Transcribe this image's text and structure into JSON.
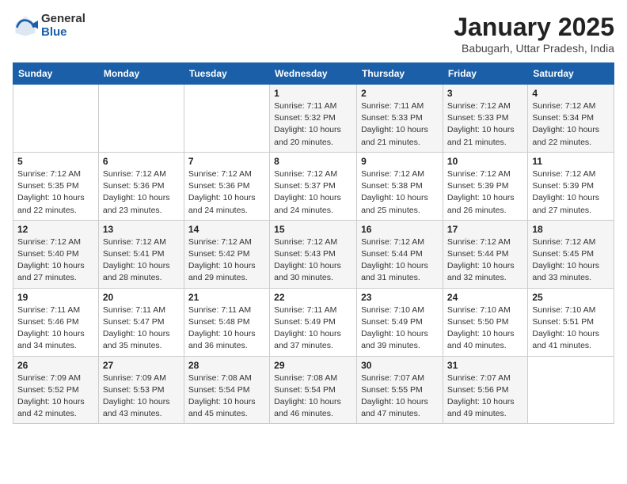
{
  "header": {
    "logo_general": "General",
    "logo_blue": "Blue",
    "title": "January 2025",
    "subtitle": "Babugarh, Uttar Pradesh, India"
  },
  "days_of_week": [
    "Sunday",
    "Monday",
    "Tuesday",
    "Wednesday",
    "Thursday",
    "Friday",
    "Saturday"
  ],
  "weeks": [
    [
      {
        "num": "",
        "info": ""
      },
      {
        "num": "",
        "info": ""
      },
      {
        "num": "",
        "info": ""
      },
      {
        "num": "1",
        "info": "Sunrise: 7:11 AM\nSunset: 5:32 PM\nDaylight: 10 hours\nand 20 minutes."
      },
      {
        "num": "2",
        "info": "Sunrise: 7:11 AM\nSunset: 5:33 PM\nDaylight: 10 hours\nand 21 minutes."
      },
      {
        "num": "3",
        "info": "Sunrise: 7:12 AM\nSunset: 5:33 PM\nDaylight: 10 hours\nand 21 minutes."
      },
      {
        "num": "4",
        "info": "Sunrise: 7:12 AM\nSunset: 5:34 PM\nDaylight: 10 hours\nand 22 minutes."
      }
    ],
    [
      {
        "num": "5",
        "info": "Sunrise: 7:12 AM\nSunset: 5:35 PM\nDaylight: 10 hours\nand 22 minutes."
      },
      {
        "num": "6",
        "info": "Sunrise: 7:12 AM\nSunset: 5:36 PM\nDaylight: 10 hours\nand 23 minutes."
      },
      {
        "num": "7",
        "info": "Sunrise: 7:12 AM\nSunset: 5:36 PM\nDaylight: 10 hours\nand 24 minutes."
      },
      {
        "num": "8",
        "info": "Sunrise: 7:12 AM\nSunset: 5:37 PM\nDaylight: 10 hours\nand 24 minutes."
      },
      {
        "num": "9",
        "info": "Sunrise: 7:12 AM\nSunset: 5:38 PM\nDaylight: 10 hours\nand 25 minutes."
      },
      {
        "num": "10",
        "info": "Sunrise: 7:12 AM\nSunset: 5:39 PM\nDaylight: 10 hours\nand 26 minutes."
      },
      {
        "num": "11",
        "info": "Sunrise: 7:12 AM\nSunset: 5:39 PM\nDaylight: 10 hours\nand 27 minutes."
      }
    ],
    [
      {
        "num": "12",
        "info": "Sunrise: 7:12 AM\nSunset: 5:40 PM\nDaylight: 10 hours\nand 27 minutes."
      },
      {
        "num": "13",
        "info": "Sunrise: 7:12 AM\nSunset: 5:41 PM\nDaylight: 10 hours\nand 28 minutes."
      },
      {
        "num": "14",
        "info": "Sunrise: 7:12 AM\nSunset: 5:42 PM\nDaylight: 10 hours\nand 29 minutes."
      },
      {
        "num": "15",
        "info": "Sunrise: 7:12 AM\nSunset: 5:43 PM\nDaylight: 10 hours\nand 30 minutes."
      },
      {
        "num": "16",
        "info": "Sunrise: 7:12 AM\nSunset: 5:44 PM\nDaylight: 10 hours\nand 31 minutes."
      },
      {
        "num": "17",
        "info": "Sunrise: 7:12 AM\nSunset: 5:44 PM\nDaylight: 10 hours\nand 32 minutes."
      },
      {
        "num": "18",
        "info": "Sunrise: 7:12 AM\nSunset: 5:45 PM\nDaylight: 10 hours\nand 33 minutes."
      }
    ],
    [
      {
        "num": "19",
        "info": "Sunrise: 7:11 AM\nSunset: 5:46 PM\nDaylight: 10 hours\nand 34 minutes."
      },
      {
        "num": "20",
        "info": "Sunrise: 7:11 AM\nSunset: 5:47 PM\nDaylight: 10 hours\nand 35 minutes."
      },
      {
        "num": "21",
        "info": "Sunrise: 7:11 AM\nSunset: 5:48 PM\nDaylight: 10 hours\nand 36 minutes."
      },
      {
        "num": "22",
        "info": "Sunrise: 7:11 AM\nSunset: 5:49 PM\nDaylight: 10 hours\nand 37 minutes."
      },
      {
        "num": "23",
        "info": "Sunrise: 7:10 AM\nSunset: 5:49 PM\nDaylight: 10 hours\nand 39 minutes."
      },
      {
        "num": "24",
        "info": "Sunrise: 7:10 AM\nSunset: 5:50 PM\nDaylight: 10 hours\nand 40 minutes."
      },
      {
        "num": "25",
        "info": "Sunrise: 7:10 AM\nSunset: 5:51 PM\nDaylight: 10 hours\nand 41 minutes."
      }
    ],
    [
      {
        "num": "26",
        "info": "Sunrise: 7:09 AM\nSunset: 5:52 PM\nDaylight: 10 hours\nand 42 minutes."
      },
      {
        "num": "27",
        "info": "Sunrise: 7:09 AM\nSunset: 5:53 PM\nDaylight: 10 hours\nand 43 minutes."
      },
      {
        "num": "28",
        "info": "Sunrise: 7:08 AM\nSunset: 5:54 PM\nDaylight: 10 hours\nand 45 minutes."
      },
      {
        "num": "29",
        "info": "Sunrise: 7:08 AM\nSunset: 5:54 PM\nDaylight: 10 hours\nand 46 minutes."
      },
      {
        "num": "30",
        "info": "Sunrise: 7:07 AM\nSunset: 5:55 PM\nDaylight: 10 hours\nand 47 minutes."
      },
      {
        "num": "31",
        "info": "Sunrise: 7:07 AM\nSunset: 5:56 PM\nDaylight: 10 hours\nand 49 minutes."
      },
      {
        "num": "",
        "info": ""
      }
    ]
  ]
}
